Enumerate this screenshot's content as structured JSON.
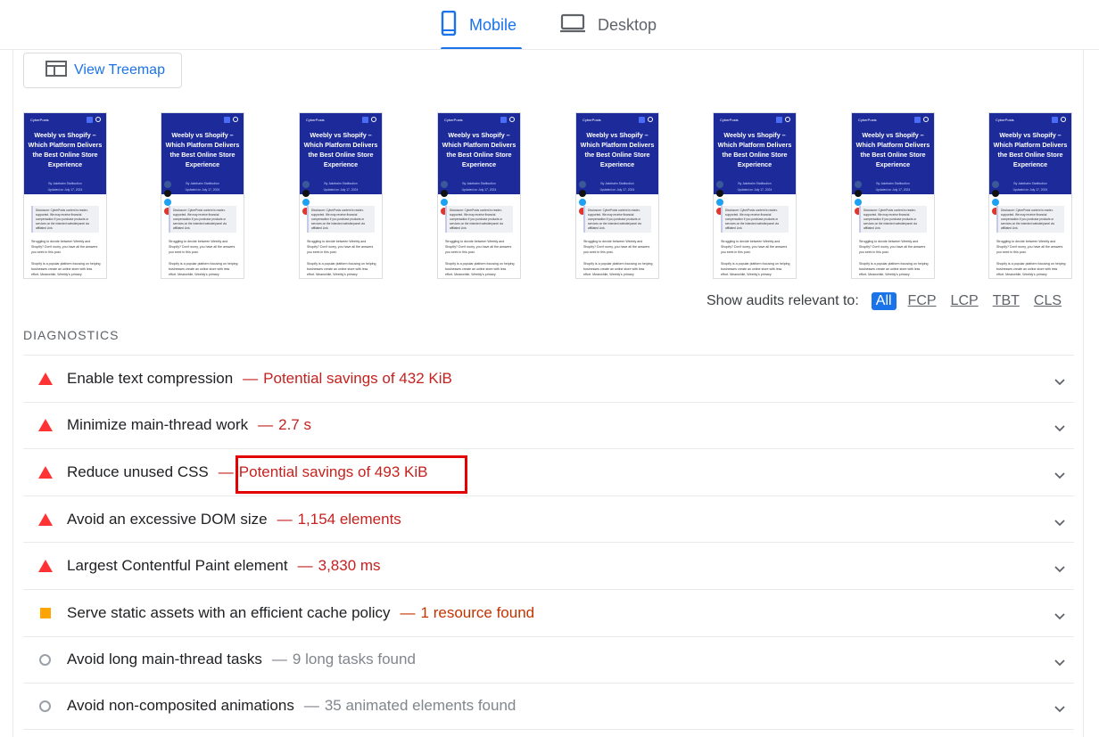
{
  "tabs": {
    "mobile_label": "Mobile",
    "desktop_label": "Desktop",
    "active": "mobile"
  },
  "treemap": {
    "label": "View Treemap"
  },
  "filmstrip": {
    "frames": [
      {
        "logo": "CyberPosts",
        "title": "Weebly vs Shopify – Which Platform Delivers the Best Online Store Experience",
        "meta": "By Jakebalm Statibudion",
        "updated": "Updated on July 17, 2024",
        "disclosure": "Disclosure: CyberPosts content is reader-supported. We may receive financial compensation if you purchase products or services on the intended website/panel via affiliated Link.",
        "p1": "Struggling to decide between Weebly and Shopify? Don't worry, you have all the answers you seek in this post.",
        "p2": "Shopify is a popular platform focusing on helping businesses create an online store with less effort. Meanwhile, Weebly's primary"
      },
      {
        "logo": "",
        "title": "Weebly vs Shopify – Which Platform Delivers the Best Online Store Experience",
        "meta": "By Jakebalm Statibudion",
        "updated": "Updated on July 17, 2024",
        "disclosure": "Disclosure: CyberPosts content is reader-supported. We may receive financial compensation if you purchase products or services on the intended website/panel via affiliated Link.",
        "p1": "Struggling to decide between Weebly and Shopify? Don't worry, you have all the answers you seek in this post.",
        "p2": "Shopify is a popular platform focusing on helping businesses create an online store with less effort. Meanwhile, Weebly's primary"
      },
      {
        "logo": "CyberPosts",
        "title": "Weebly vs Shopify – Which Platform Delivers the Best Online Store Experience",
        "meta": "By Jakebalm Statibudion",
        "updated": "Updated on July 17, 2024",
        "disclosure": "Disclosure: CyberPosts content is reader-supported. We may receive financial compensation if you purchase products or services on the intended website/panel via affiliated Link.",
        "p1": "Struggling to decide between Weebly and Shopify? Don't worry, you have all the answers you seek in this post.",
        "p2": "Shopify is a popular platform focusing on helping businesses create an online store with less effort. Meanwhile, Weebly's primary"
      },
      {
        "logo": "CyberPosts",
        "title": "Weebly vs Shopify – Which Platform Delivers the Best Online Store Experience",
        "meta": "By Jakebalm Statibudion",
        "updated": "Updated on July 17, 2024",
        "disclosure": "Disclosure: CyberPosts content is reader-supported. We may receive financial compensation if you purchase products or services on the intended website/panel via affiliated Link.",
        "p1": "Struggling to decide between Weebly and Shopify? Don't worry, you have all the answers you seek in this post.",
        "p2": "Shopify is a popular platform focusing on helping businesses create an online store with less effort. Meanwhile, Weebly's primary"
      },
      {
        "logo": "CyberPosts",
        "title": "Weebly vs Shopify – Which Platform Delivers the Best Online Store Experience",
        "meta": "By Jakebalm Statibudion",
        "updated": "Updated on July 17, 2024",
        "disclosure": "Disclosure: CyberPosts content is reader-supported. We may receive financial compensation if you purchase products or services on the intended website/panel via affiliated Link.",
        "p1": "Struggling to decide between Weebly and Shopify? Don't worry, you have all the answers you seek in this post.",
        "p2": "Shopify is a popular platform focusing on helping businesses create an online store with less effort. Meanwhile, Weebly's primary"
      },
      {
        "logo": "CyberPosts",
        "title": "Weebly vs Shopify – Which Platform Delivers the Best Online Store Experience",
        "meta": "By Jakebalm Statibudion",
        "updated": "Updated on July 17, 2024",
        "disclosure": "Disclosure: CyberPosts content is reader-supported. We may receive financial compensation if you purchase products or services on the intended website/panel via affiliated Link.",
        "p1": "Struggling to decide between Weebly and Shopify? Don't worry, you have all the answers you seek in this post.",
        "p2": "Shopify is a popular platform focusing on helping businesses create an online store with less effort. Meanwhile, Weebly's primary"
      },
      {
        "logo": "CyberPosts",
        "title": "Weebly vs Shopify – Which Platform Delivers the Best Online Store Experience",
        "meta": "By Jakebalm Statibudion",
        "updated": "Updated on July 17, 2024",
        "disclosure": "Disclosure: CyberPosts content is reader-supported. We may receive financial compensation if you purchase products or services on the intended website/panel via affiliated Link.",
        "p1": "Struggling to decide between Weebly and Shopify? Don't worry, you have all the answers you seek in this post.",
        "p2": "Shopify is a popular platform focusing on helping businesses create an online store with less effort. Meanwhile, Weebly's primary"
      },
      {
        "logo": "CyberPosts",
        "title": "Weebly vs Shopify – Which Platform Delivers the Best Online Store Experience",
        "meta": "By Jakebalm Statibudion",
        "updated": "Updated on July 17, 2024",
        "disclosure": "Disclosure: CyberPosts content is reader-supported. We may receive financial compensation if you purchase products or services on the intended website/panel via affiliated Link.",
        "p1": "Struggling to decide between Weebly and Shopify? Don't worry, you have all the answers you seek in this post.",
        "p2": "Shopify is a popular platform focusing on helping businesses create an online store with less effort. Meanwhile, Weebly's primary"
      }
    ]
  },
  "filters": {
    "label": "Show audits relevant to:",
    "options": [
      "All",
      "FCP",
      "LCP",
      "TBT",
      "CLS"
    ],
    "active": "All"
  },
  "diagnostics": {
    "title": "DIAGNOSTICS",
    "items": [
      {
        "status": "fail",
        "icon": "red-triangle-icon",
        "title": "Enable text compression",
        "sep": "—",
        "detail": "Potential savings of 432 KiB"
      },
      {
        "status": "fail",
        "icon": "red-triangle-icon",
        "title": "Minimize main-thread work",
        "sep": "—",
        "detail": "2.7 s"
      },
      {
        "status": "fail",
        "icon": "red-triangle-icon",
        "title": "Reduce unused CSS",
        "sep": "—",
        "detail": "Potential savings of 493 KiB"
      },
      {
        "status": "fail",
        "icon": "red-triangle-icon",
        "title": "Avoid an excessive DOM size",
        "sep": "—",
        "detail": "1,154 elements"
      },
      {
        "status": "fail",
        "icon": "red-triangle-icon",
        "title": "Largest Contentful Paint element",
        "sep": "—",
        "detail": "3,830 ms"
      },
      {
        "status": "avg",
        "icon": "orange-square-icon",
        "title": "Serve static assets with an efficient cache policy",
        "sep": "—",
        "detail": "1 resource found"
      },
      {
        "status": "info",
        "icon": "gray-circle-icon",
        "title": "Avoid long main-thread tasks",
        "sep": "—",
        "detail": "9 long tasks found"
      },
      {
        "status": "info",
        "icon": "gray-circle-icon",
        "title": "Avoid non-composited animations",
        "sep": "—",
        "detail": "35 animated elements found"
      }
    ]
  },
  "colors": {
    "accent": "#1a73e8",
    "fail": "#f33333",
    "fail_text": "#c5221f",
    "avg": "#ffa400",
    "hero": "#1d2b9a",
    "highlight": "#e30000"
  }
}
